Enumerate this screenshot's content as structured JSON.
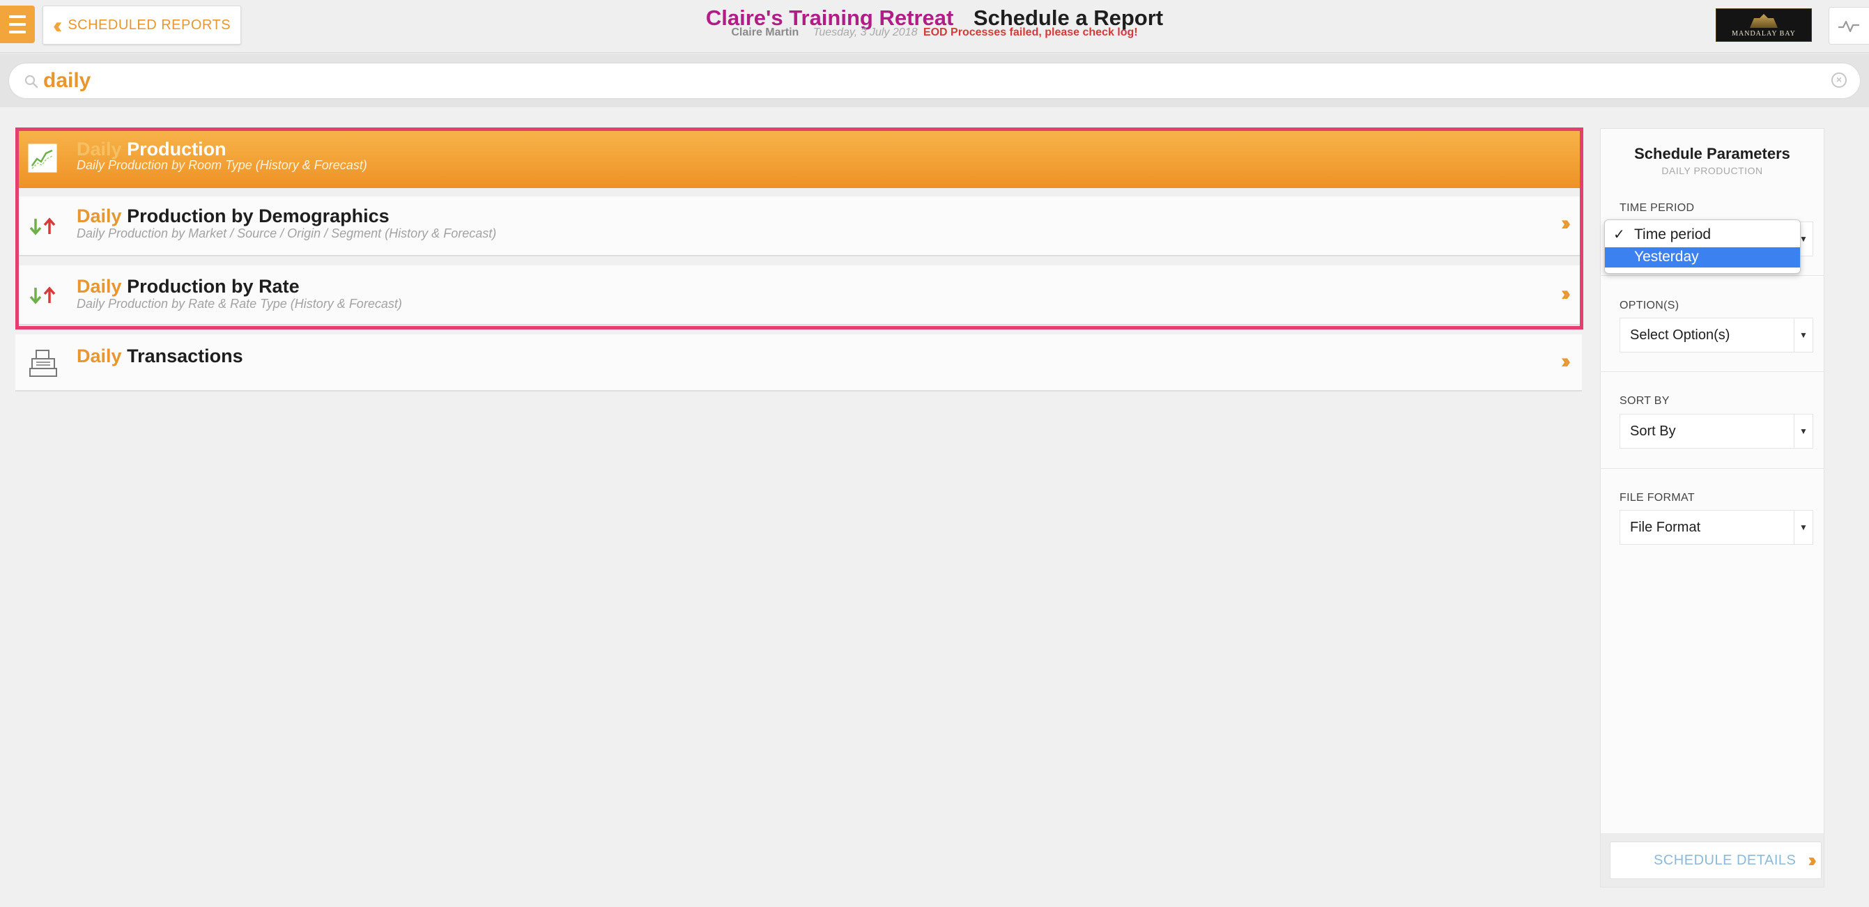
{
  "header": {
    "back_label": "SCHEDULED REPORTS",
    "hotel_name": "Claire's Training Retreat",
    "page_title": "Schedule a Report",
    "user_name": "Claire Martin",
    "date": "Tuesday, 3 July 2018",
    "warning": "EOD Processes failed, please check log!",
    "logo_text": "MANDALAY BAY"
  },
  "search": {
    "value": "daily"
  },
  "reports": [
    {
      "keyword": "Daily",
      "title": "Production",
      "description": "Daily Production by Room Type (History & Forecast)",
      "icon": "line-chart-icon"
    },
    {
      "keyword": "Daily",
      "title": "Production by Demographics",
      "description": "Daily Production by Market / Source / Origin / Segment (History & Forecast)",
      "icon": "up-down-arrows-icon"
    },
    {
      "keyword": "Daily",
      "title": "Production by Rate",
      "description": "Daily Production by Rate & Rate Type (History & Forecast)",
      "icon": "up-down-arrows-icon"
    },
    {
      "keyword": "Daily",
      "title": "Transactions",
      "description": "",
      "icon": "register-icon"
    }
  ],
  "panel": {
    "title": "Schedule Parameters",
    "subtitle": "DAILY PRODUCTION",
    "time_period_label": "TIME PERIOD",
    "time_period_options": [
      "Time period",
      "Yesterday"
    ],
    "options_label": "OPTION(S)",
    "options_value": "Select Option(s)",
    "sort_label": "SORT BY",
    "sort_value": "Sort By",
    "format_label": "FILE FORMAT",
    "format_value": "File Format",
    "schedule_button": "SCHEDULE DETAILS"
  },
  "colors": {
    "accent": "#e8962e",
    "hotel_name": "#b01d86",
    "warning": "#d43a3a",
    "highlight_border": "#e4406f",
    "dropdown_selected": "#3b82f0"
  }
}
